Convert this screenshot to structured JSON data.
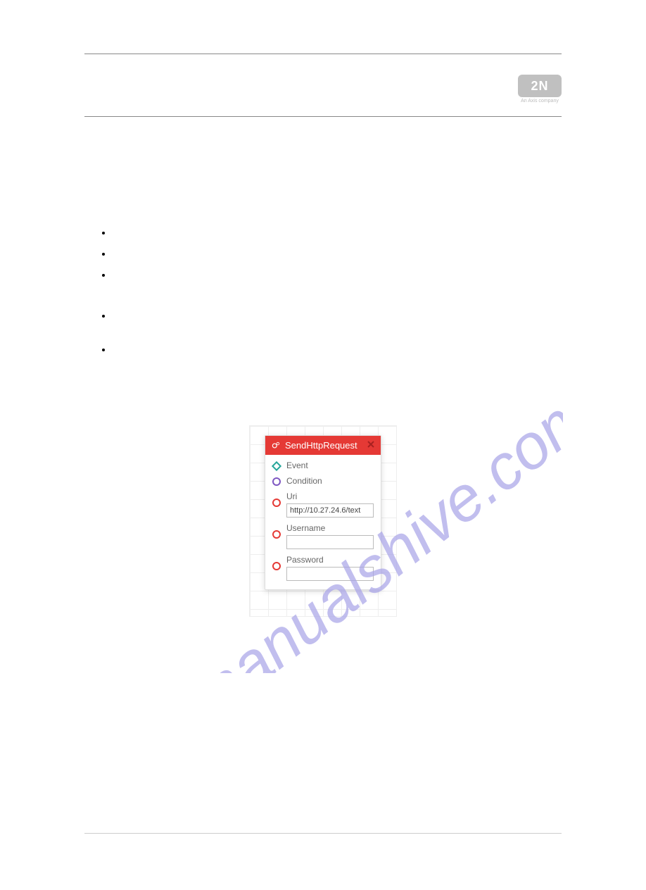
{
  "logo": {
    "text": "2N",
    "subtitle": "An Axis company"
  },
  "bullets": [
    "",
    "",
    "",
    "",
    ""
  ],
  "watermark": "manualshive.com",
  "widget": {
    "title": "SendHttpRequest",
    "rows": {
      "event": "Event",
      "condition": "Condition",
      "uri_label": "Uri",
      "uri_value": "http://10.27.24.6/text",
      "username_label": "Username",
      "username_value": "",
      "password_label": "Password",
      "password_value": ""
    }
  }
}
